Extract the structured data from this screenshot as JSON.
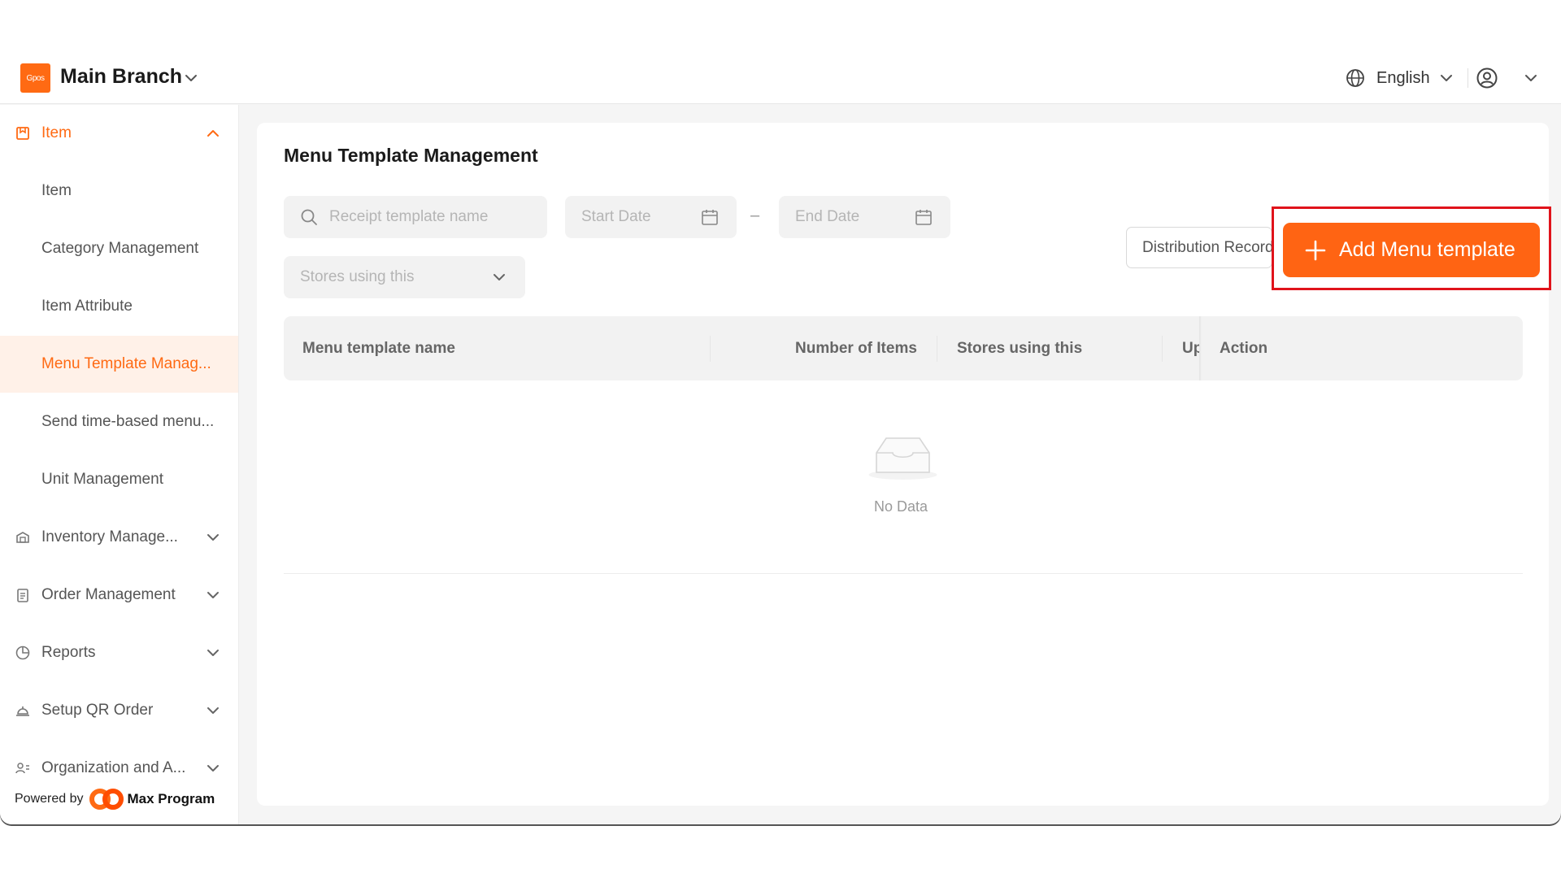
{
  "header": {
    "logo_text": "Gpos",
    "branch_name": "Main Branch",
    "language": "English"
  },
  "sidebar": {
    "groups": [
      {
        "label": "Item",
        "icon": "bookmark-box-icon",
        "expanded": true
      },
      {
        "label": "Inventory Manage...",
        "icon": "warehouse-icon"
      },
      {
        "label": "Order Management",
        "icon": "clipboard-icon"
      },
      {
        "label": "Reports",
        "icon": "pie-chart-icon"
      },
      {
        "label": "Setup QR Order",
        "icon": "service-bell-icon"
      },
      {
        "label": "Organization and A...",
        "icon": "people-icon"
      }
    ],
    "sub_items": [
      {
        "label": "Item"
      },
      {
        "label": "Category Management"
      },
      {
        "label": "Item Attribute"
      },
      {
        "label": "Menu Template Manag...",
        "selected": true
      },
      {
        "label": "Send time-based menu..."
      },
      {
        "label": "Unit Management"
      }
    ],
    "powered_by": "Powered by",
    "brand": "Max Program"
  },
  "main": {
    "title": "Menu Template Management",
    "filters": {
      "search_placeholder": "Receipt template name",
      "start_date_placeholder": "Start Date",
      "date_separator": "–",
      "end_date_placeholder": "End Date",
      "stores_placeholder": "Stores using this"
    },
    "buttons": {
      "distribution": "Distribution Record",
      "add": "Add Menu template"
    },
    "table": {
      "columns": [
        "Menu template name",
        "Number of Items",
        "Stores using this",
        "Up",
        "Action"
      ],
      "empty_text": "No Data"
    }
  },
  "colors": {
    "accent": "#ff6413",
    "selected_bg": "#fff1e8",
    "highlight": "#e0131b"
  }
}
